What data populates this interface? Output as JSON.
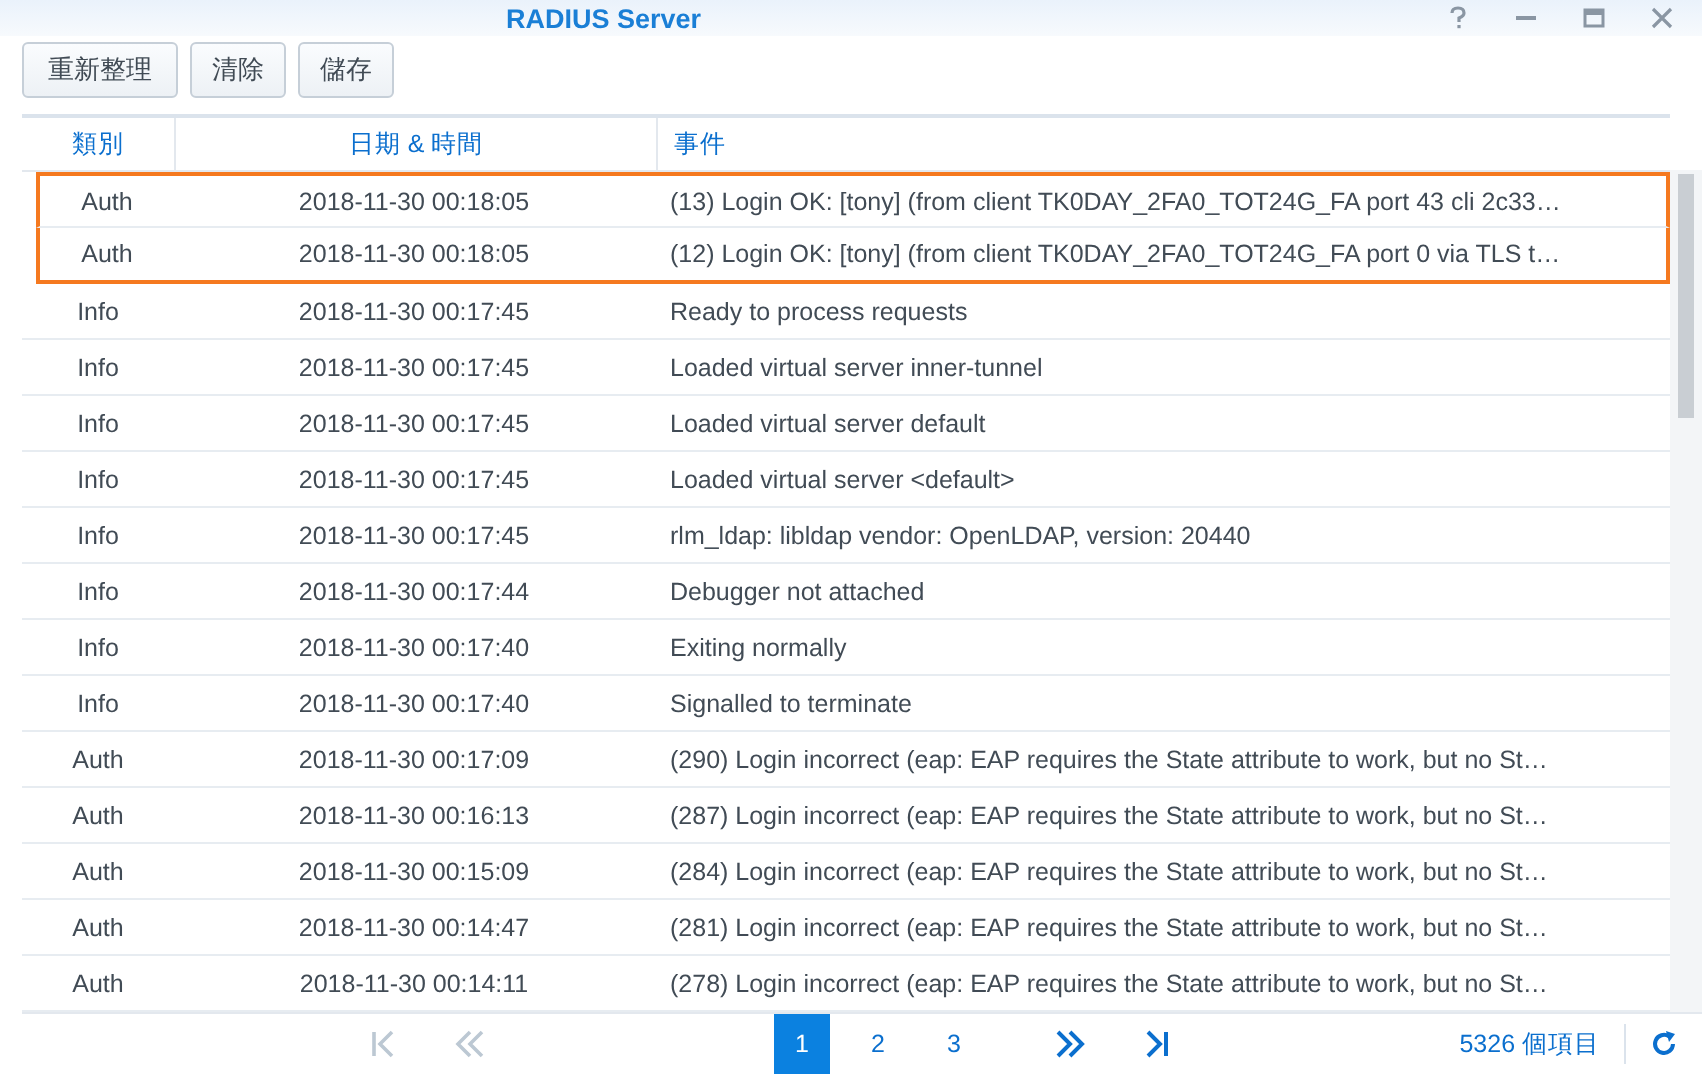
{
  "window": {
    "title": "RADIUS Server"
  },
  "toolbar": [
    "重新整理",
    "清除",
    "儲存"
  ],
  "table": {
    "columns": [
      "類別",
      "日期 & 時間",
      "事件"
    ],
    "rows": [
      {
        "type": "Auth",
        "time": "2018-11-30 00:18:05",
        "event": "(13) Login OK: [tony] (from client TK0DAY_2FA0_TOT24G_FA port 43 cli 2c33…",
        "highlighted": true
      },
      {
        "type": "Auth",
        "time": "2018-11-30 00:18:05",
        "event": "(12) Login OK: [tony] (from client TK0DAY_2FA0_TOT24G_FA port 0 via TLS t…",
        "highlighted": true
      },
      {
        "type": "Info",
        "time": "2018-11-30 00:17:45",
        "event": "Ready to process requests",
        "highlighted": false
      },
      {
        "type": "Info",
        "time": "2018-11-30 00:17:45",
        "event": "Loaded virtual server inner-tunnel",
        "highlighted": false
      },
      {
        "type": "Info",
        "time": "2018-11-30 00:17:45",
        "event": "Loaded virtual server default",
        "highlighted": false
      },
      {
        "type": "Info",
        "time": "2018-11-30 00:17:45",
        "event": "Loaded virtual server <default>",
        "highlighted": false
      },
      {
        "type": "Info",
        "time": "2018-11-30 00:17:45",
        "event": "rlm_ldap: libldap vendor: OpenLDAP, version: 20440",
        "highlighted": false
      },
      {
        "type": "Info",
        "time": "2018-11-30 00:17:44",
        "event": "Debugger not attached",
        "highlighted": false
      },
      {
        "type": "Info",
        "time": "2018-11-30 00:17:40",
        "event": "Exiting normally",
        "highlighted": false
      },
      {
        "type": "Info",
        "time": "2018-11-30 00:17:40",
        "event": "Signalled to terminate",
        "highlighted": false
      },
      {
        "type": "Auth",
        "time": "2018-11-30 00:17:09",
        "event": "(290) Login incorrect (eap: EAP requires the State attribute to work, but no St…",
        "highlighted": false
      },
      {
        "type": "Auth",
        "time": "2018-11-30 00:16:13",
        "event": "(287) Login incorrect (eap: EAP requires the State attribute to work, but no St…",
        "highlighted": false
      },
      {
        "type": "Auth",
        "time": "2018-11-30 00:15:09",
        "event": "(284) Login incorrect (eap: EAP requires the State attribute to work, but no St…",
        "highlighted": false
      },
      {
        "type": "Auth",
        "time": "2018-11-30 00:14:47",
        "event": "(281) Login incorrect (eap: EAP requires the State attribute to work, but no St…",
        "highlighted": false
      },
      {
        "type": "Auth",
        "time": "2018-11-30 00:14:11",
        "event": "(278) Login incorrect (eap: EAP requires the State attribute to work, but no St…",
        "highlighted": false
      }
    ]
  },
  "pager": {
    "first_disabled": true,
    "prev_disabled": true,
    "next_disabled": false,
    "last_disabled": false,
    "pages": [
      {
        "label": "1",
        "selected": true
      },
      {
        "label": "2",
        "selected": false
      },
      {
        "label": "3",
        "selected": false
      }
    ],
    "count": "5326 個項目"
  }
}
